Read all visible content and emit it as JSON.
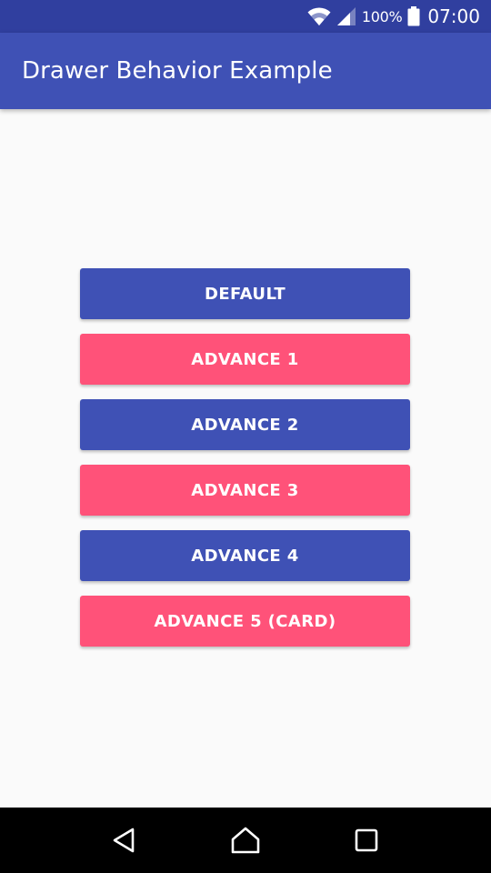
{
  "status_bar": {
    "battery_percent": "100%",
    "time": "07:00",
    "icons": [
      "wifi-icon",
      "cell-signal-icon",
      "battery-icon"
    ]
  },
  "app_bar": {
    "title": "Drawer Behavior Example"
  },
  "buttons": [
    {
      "label": "DEFAULT",
      "style": "primary"
    },
    {
      "label": "ADVANCE 1",
      "style": "accent"
    },
    {
      "label": "ADVANCE 2",
      "style": "primary"
    },
    {
      "label": "ADVANCE 3",
      "style": "accent"
    },
    {
      "label": "ADVANCE 4",
      "style": "primary"
    },
    {
      "label": "ADVANCE 5 (CARD)",
      "style": "accent"
    }
  ],
  "navigation_bar": {
    "icons": [
      "back-icon",
      "home-icon",
      "recents-icon"
    ]
  },
  "colors": {
    "primary": "#3F51B5",
    "primary_dark": "#303F9F",
    "accent": "#FF5279",
    "background": "#FAFAFA"
  }
}
